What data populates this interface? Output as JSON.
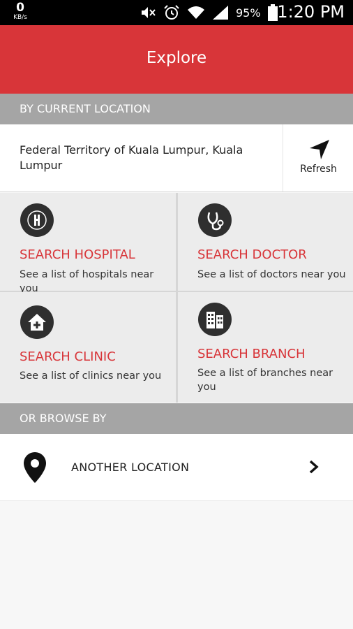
{
  "status_bar": {
    "data_rate": "0",
    "data_rate_unit": "KB/s",
    "battery": "95%",
    "time": "1:20 PM",
    "icons": [
      "mute-icon",
      "alarm-icon",
      "wifi-icon",
      "signal-icon",
      "battery-icon"
    ]
  },
  "app_bar": {
    "title": "Explore"
  },
  "current_location": {
    "header": "BY CURRENT LOCATION",
    "address": "Federal Territory of Kuala Lumpur, Kuala Lumpur",
    "refresh_label": "Refresh",
    "refresh_icon": "navigation-arrow-icon"
  },
  "search_tiles": [
    {
      "title": "SEARCH HOSPITAL",
      "description": "See a list of hospitals near you",
      "icon": "hospital-icon"
    },
    {
      "title": "SEARCH DOCTOR",
      "description": "See a list of doctors near you",
      "icon": "stethoscope-icon"
    },
    {
      "title": "SEARCH CLINIC",
      "description": "See a list of clinics near you",
      "icon": "clinic-icon"
    },
    {
      "title": "SEARCH BRANCH",
      "description": "See a list of branches near you",
      "icon": "building-icon"
    }
  ],
  "browse": {
    "header": "OR BROWSE BY",
    "items": [
      {
        "label": "ANOTHER LOCATION",
        "icon": "location-pin-icon",
        "trailing_icon": "chevron-right-icon"
      }
    ]
  },
  "colors": {
    "accent": "#d83539",
    "section_header_bg": "#a5a5a5",
    "tile_bg": "#ececec",
    "icon_dark": "#2f2f2f"
  }
}
